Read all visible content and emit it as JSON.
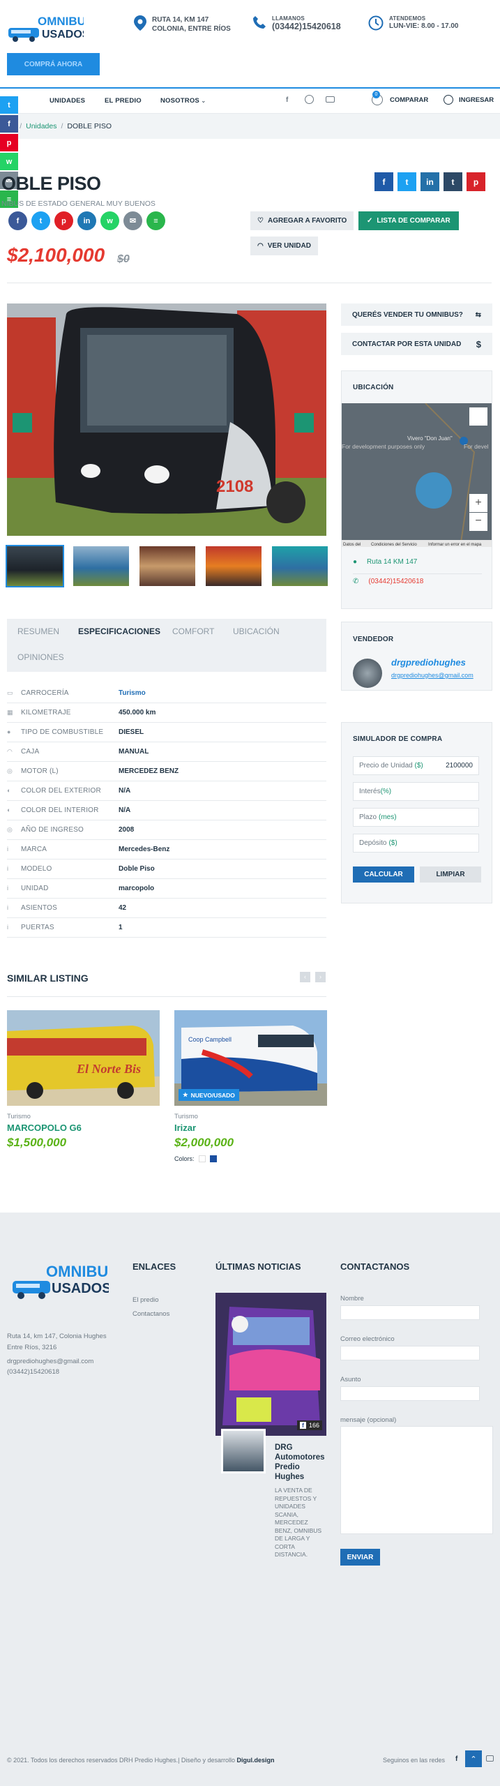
{
  "header": {
    "logo_line1": "OMNIBUS",
    "logo_line2": "USADOS",
    "address_line1": "RUTA 14, KM 147",
    "address_line2": "COLONIA, ENTRE RÍOS",
    "call_label": "LLAMANOS",
    "call_number": "(03442)15420618",
    "hours_label": "ATENDEMOS",
    "hours_value": "LUN-VIE: 8.00 - 17.00",
    "cta_label": "COMPRÁ AHORA"
  },
  "nav": {
    "items": [
      "IO",
      "UNIDADES",
      "EL PREDIO",
      "NOSOTROS"
    ],
    "compare_label": "COMPARAR",
    "compare_count": "0",
    "login_label": "INGRESAR"
  },
  "breadcrumb": {
    "first": "io",
    "second": "Unidades",
    "current": "DOBLE PISO",
    "sep": "/"
  },
  "listing": {
    "title": "OBLE PISO",
    "subtitle": "NIBUS DE ESTADO GENERAL MUY BUENOS",
    "favorite_label": "AGREGAR A FAVORITO",
    "compare_label": "LISTA DE COMPARAR",
    "view_label": "VER UNIDAD",
    "price": "$2,100,000",
    "old_price": "$0"
  },
  "sidebar": {
    "sell_label": "QUERÉS VENDER TU OMNIBUS?",
    "contact_label": "CONTACTAR POR ESTA UNIDAD",
    "location_title": "UBICACIÓN",
    "map_text_left": "For development purposes only",
    "map_text_right": "For devel",
    "map_place": "Vivero \"Don Juan\"",
    "map_footer_a": "Datos del",
    "map_footer_b": "Condiciones del Servicio",
    "map_footer_c": "Informar un error en el mapa",
    "location_address": "Ruta 14 KM 147",
    "location_phone": "(03442)15420618",
    "seller_title": "VENDEDOR",
    "seller_name": "drgprediohughes",
    "seller_email": "drgprediohughes@gmail.com",
    "sim_title": "SIMULADOR DE COMPRA",
    "sim_price_label": "Precio de Unidad",
    "sim_price_unit": "($)",
    "sim_price_value": "2100000",
    "sim_interest_label": "Interés",
    "sim_interest_unit": "(%)",
    "sim_term_label": "Plazo",
    "sim_term_unit": "(mes)",
    "sim_deposit_label": "Depósito",
    "sim_deposit_unit": "($)",
    "sim_calc": "CALCULAR",
    "sim_clear": "LIMPIAR"
  },
  "tabs": [
    "RESUMEN",
    "ESPECIFICACIONES",
    "COMFORT",
    "UBICACIÓN",
    "OPINIONES"
  ],
  "specs": [
    {
      "key": "CARROCERÍA",
      "value": "Turismo"
    },
    {
      "key": "KILOMETRAJE",
      "value": "450.000 km"
    },
    {
      "key": "TIPO DE COMBUSTIBLE",
      "value": "DIESEL"
    },
    {
      "key": "CAJA",
      "value": "MANUAL"
    },
    {
      "key": "MOTOR (L)",
      "value": "MERCEDEZ BENZ"
    },
    {
      "key": "COLOR DEL EXTERIOR",
      "value": "N/A"
    },
    {
      "key": "COLOR DEL INTERIOR",
      "value": "N/A"
    },
    {
      "key": "AÑO DE INGRESO",
      "value": "2008"
    },
    {
      "key": "MARCA",
      "value": "Mercedes-Benz"
    },
    {
      "key": "MODELO",
      "value": "Doble Piso"
    },
    {
      "key": "UNIDAD",
      "value": "marcopolo"
    },
    {
      "key": "ASIENTOS",
      "value": "42"
    },
    {
      "key": "PUERTAS",
      "value": "1"
    }
  ],
  "similar": {
    "heading": "SIMILAR LISTING",
    "items": [
      {
        "category": "Turismo",
        "name": "MARCOPOLO G6",
        "price": "$1,500,000",
        "img_text": "El Norte Bis"
      },
      {
        "category": "Turismo",
        "name": "Irizar",
        "price": "$2,000,000",
        "badge": "NUEVO/USADO",
        "colors_label": "Colors:",
        "img_text": "Coop Campbell"
      }
    ]
  },
  "footer": {
    "address": "Ruta 14, km 147, Colonia Hughes Entre Ríos, 3216",
    "email": "drgprediohughes@gmail.com",
    "phone": "(03442)15420618",
    "links_title": "ENLACES",
    "links": [
      "El predio",
      "Contactanos"
    ],
    "news_title": "ÚLTIMAS NOTICIAS",
    "news_count": "166",
    "news_author": "DRG Automotores Predio Hughes",
    "news_excerpt": "LA VENTA DE REPUESTOS Y UNIDADES SCANIA, MERCEDEZ BENZ, OMNIBUS DE LARGA Y CORTA DISTANCIA.",
    "contact_title": "CONTACTANOS",
    "name_label": "Nombre",
    "email_label": "Correo electrónico",
    "subject_label": "Asunto",
    "message_label": "mensaje (opcional)",
    "send_label": "ENVIAR",
    "copyright": "© 2021. Todos los derechos reservados DRH Predio Hughes.| Diseño y desarrollo ",
    "copyright_brand": "Digul.design",
    "follow": "Seguinos en las redes"
  },
  "colors": {
    "accent": "#1f8be0",
    "green": "#1c9573",
    "price": "#e53a31",
    "lime": "#5bb318"
  }
}
